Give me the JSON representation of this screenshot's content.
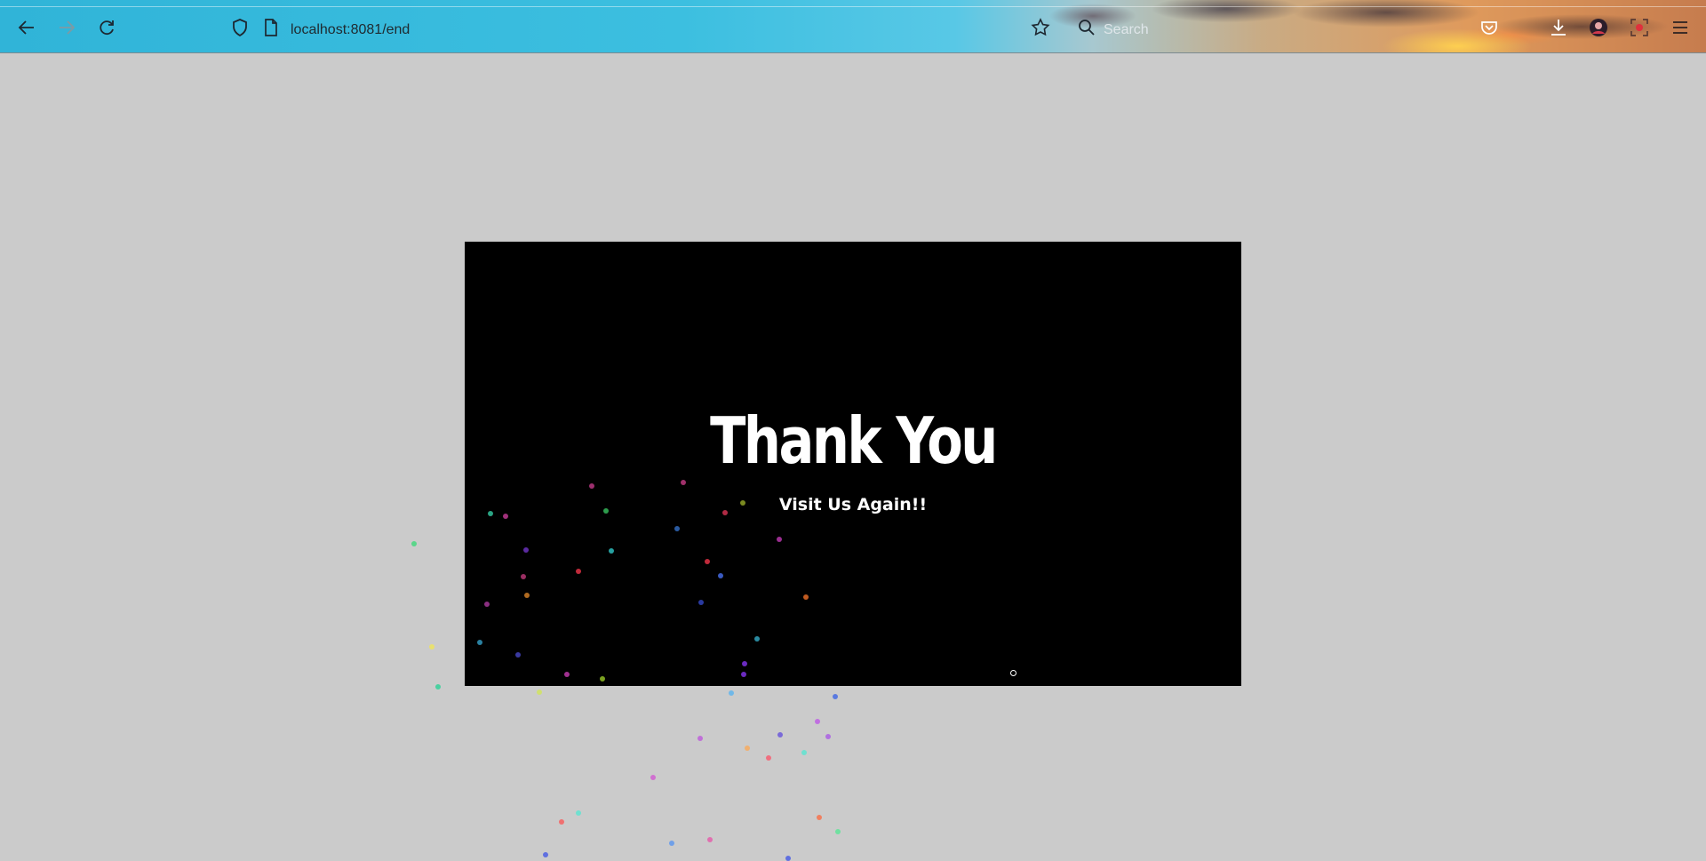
{
  "browser": {
    "url": "localhost:8081/end",
    "search_placeholder": "Search",
    "icons": {
      "back": "arrow-left-icon",
      "forward": "arrow-right-icon",
      "reload": "reload-icon",
      "shield": "shield-icon",
      "page": "page-icon",
      "bookmark": "star-icon",
      "search": "search-icon",
      "pocket": "pocket-icon",
      "downloads": "download-icon",
      "account": "avatar-icon",
      "screenshot": "screenshot-icon",
      "menu": "hamburger-menu-icon"
    }
  },
  "page": {
    "title": "Thank You",
    "subtitle": "Visit Us Again!!"
  },
  "colors": {
    "page_background": "#cbcbcb",
    "stage_background": "#000000",
    "text": "#ffffff"
  }
}
